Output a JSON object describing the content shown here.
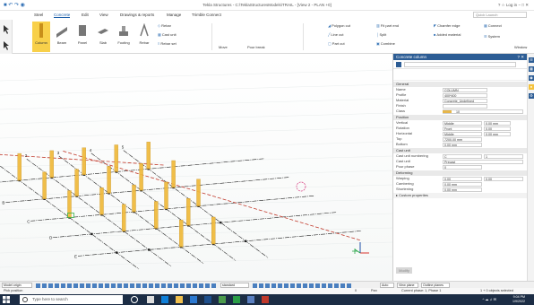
{
  "titlebar": {
    "title": "Tekla Structures - C:\\TeklaStructuresModels\\TRAIL - [View 2 - PLAN +0]",
    "right_text": "? ☆ Log in − □ ✕"
  },
  "menu": {
    "tabs": [
      "Steel",
      "Concrete",
      "Edit",
      "View",
      "Drawings & reports",
      "Manage",
      "Trimble Connect"
    ],
    "active": "Concrete",
    "search_placeholder": "Quick Launch"
  },
  "ribbon": {
    "large_buttons": [
      "Column",
      "Beam",
      "Panel",
      "Slab",
      "Footing",
      "Rebar"
    ],
    "items_a": [
      "Rebar",
      "Cast unit",
      "Rebar set"
    ],
    "items_b": [
      "Move",
      "Pour break"
    ],
    "items_c": [
      "Polygon cut",
      "Line cut",
      "Part cut",
      "Fit part end",
      "Split",
      "Combine",
      "Chamfer edge",
      "Added material",
      "Connect",
      "System",
      "Window"
    ]
  },
  "panel": {
    "title": "Concrete column",
    "sections": {
      "general": "General",
      "position": "Position",
      "cast_unit": "Cast unit",
      "deforming": "Deforming",
      "custom": "Custom properties"
    },
    "general": [
      {
        "label": "Name",
        "value": "COLUMN"
      },
      {
        "label": "Profile",
        "value": "400*400"
      },
      {
        "label": "Material",
        "value": "Concrete_Undefined"
      },
      {
        "label": "Finish",
        "value": ""
      },
      {
        "label": "Class",
        "value": "10"
      }
    ],
    "position": [
      {
        "label": "Vertical",
        "value": "Middle",
        "extra": "0.00 mm"
      },
      {
        "label": "Rotation",
        "value": "Front",
        "extra": "0.00"
      },
      {
        "label": "Horizontal",
        "value": "Middle",
        "extra": "0.00 mm"
      },
      {
        "label": "Top",
        "value": "7200.00 mm",
        "extra": ""
      },
      {
        "label": "Bottom",
        "value": "0.00 mm",
        "extra": ""
      }
    ],
    "cast_unit": [
      {
        "label": "Cast unit numbering",
        "value": "C",
        "extra": "1"
      },
      {
        "label": "Cast unit",
        "value": "Precast",
        "extra": ""
      },
      {
        "label": "Pour phase",
        "value": "0",
        "extra": ""
      }
    ],
    "deforming": [
      {
        "label": "Warping",
        "value": "0.00",
        "extra": "0.00"
      },
      {
        "label": "Cambering",
        "value": "0.00 mm",
        "extra": ""
      },
      {
        "label": "Shortening",
        "value": "0.00 mm",
        "extra": ""
      }
    ],
    "modify": "Modify"
  },
  "statusbar": {
    "snap": "Model origin",
    "standard": "standard",
    "auto": "Auto",
    "planes": "View plane",
    "outline": "Outline planes"
  },
  "statusline": {
    "left": "Pick position",
    "mid_a": "0",
    "mid_b": "Pan",
    "phase": "Current phase: 1, Phase 1",
    "selected": "1 + 0 objects selected"
  },
  "taskbar": {
    "search": "Type here to search",
    "time": "9:04 PM",
    "date": "1/9/2022"
  },
  "grid_labels": {
    "letters": [
      "A",
      "B",
      "C",
      "D",
      "E"
    ],
    "numbers": [
      "1",
      "2",
      "3",
      "4",
      "5"
    ]
  },
  "colors": {
    "column": "#f0b93a",
    "grid": "#222222",
    "accent": "#2d5d95"
  }
}
